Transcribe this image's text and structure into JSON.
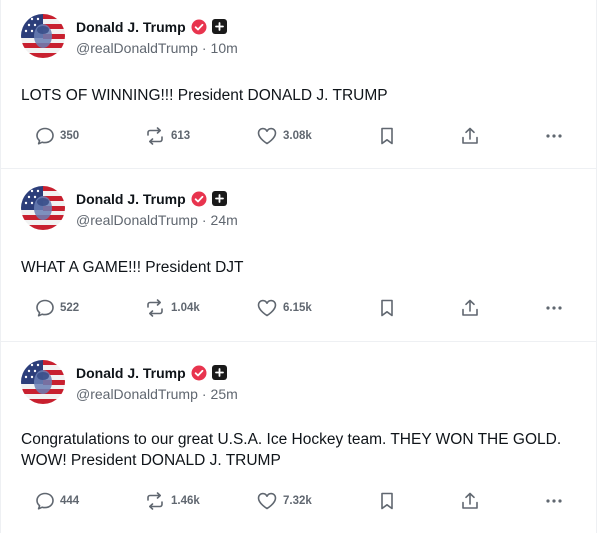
{
  "posts": [
    {
      "author_name": "Donald J. Trump",
      "handle": "@realDonaldTrump",
      "separator": "·",
      "time": "10m",
      "text": "LOTS OF WINNING!!! President DONALD J. TRUMP",
      "replies": "350",
      "reposts": "613",
      "likes": "3.08k"
    },
    {
      "author_name": "Donald J. Trump",
      "handle": "@realDonaldTrump",
      "separator": "·",
      "time": "24m",
      "text": "WHAT A GAME!!! President DJT",
      "replies": "522",
      "reposts": "1.04k",
      "likes": "6.15k"
    },
    {
      "author_name": "Donald J. Trump",
      "handle": "@realDonaldTrump",
      "separator": "·",
      "time": "25m",
      "text": "Congratulations to our great U.S.A. Ice Hockey team. THEY WON THE GOLD. WOW! President DONALD J. TRUMP",
      "replies": "444",
      "reposts": "1.46k",
      "likes": "7.32k"
    }
  ],
  "icons": {
    "verified": "verified-badge-icon",
    "square_badge": "plus-badge-icon",
    "reply": "reply-icon",
    "repost": "repost-icon",
    "like": "heart-icon",
    "bookmark": "bookmark-icon",
    "share": "share-icon",
    "more": "more-icon"
  },
  "colors": {
    "verified": "#e8344e",
    "text": "#0f1419",
    "muted": "#606770",
    "divider": "#eef0f3"
  }
}
